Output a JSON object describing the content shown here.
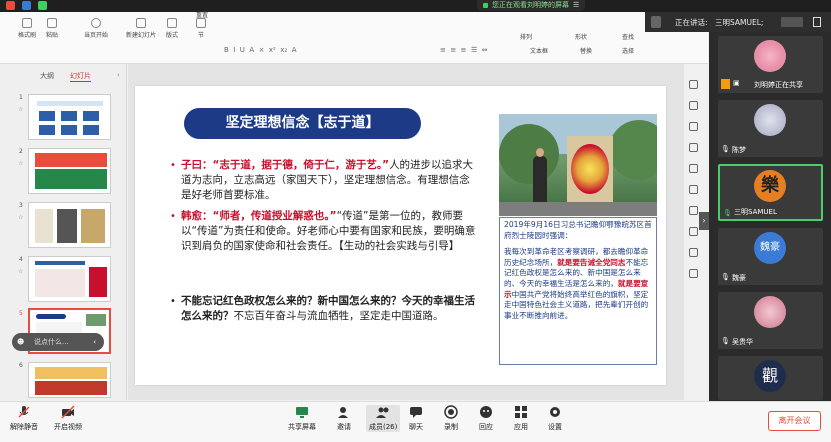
{
  "notice": {
    "text": "您正在观看刘明婷的屏幕"
  },
  "speaking": {
    "label": "正在讲话:",
    "name": "三明SAMUEL;"
  },
  "toolbar": {
    "buttons": [
      "格式刷",
      "粘贴",
      "当页开始",
      "新建幻灯片",
      "版式",
      "节",
      "重置",
      "文本框",
      "形状",
      "排列",
      "查找",
      "选择",
      "替换"
    ]
  },
  "thumbpanel": {
    "tab_outline": "大纲",
    "tab_slides": "幻灯片",
    "numbers": [
      "1",
      "2",
      "3",
      "4",
      "5",
      "6"
    ]
  },
  "slide": {
    "title": "坚定理想信念【志于道】",
    "p1_quote": "子曰：“志于道，据于德，倚于仁，游于艺。”",
    "p1_rest": "人的进步以追求大道为志向，立志高远（家国天下），坚定理想信念。有理想信念是好老师首要标准。",
    "p2_quote": "韩愈：“师者，传道授业解惑也。”",
    "p2_rest": "“传道”是第一位的，教师要以“传道”为责任和使命。好老师心中要有国家和民族，要明确意识到肩负的国家使命和社会责任。【生动的社会实践与引导】",
    "p3_bold": "不能忘记红色政权怎么来的？新中国怎么来的？今天的幸福生活怎么来的？",
    "p3_rest": "不忘百年奋斗与流血牺牲，坚定走中国道路。",
    "caption_head": "2019年9月16日习总书记瞻仰鄂豫皖苏区首府烈士陵园时强调：",
    "caption_a": "我每次到革命老区考察调研，都去瞻仰革命历史纪念场所，",
    "caption_b": "就是要告诫全党同志",
    "caption_c": "不能忘记红色政权是怎么来的、新中国是怎么来的、今天的幸福生活是怎么来的，",
    "caption_d": "就是要宣示",
    "caption_e": "中国共产党将始终高举红色的旗帜，坚定走中国特色社会主义道路，把先辈们开创的事业不断推向前进。"
  },
  "participants": [
    {
      "name": "刘明婷正在共享"
    },
    {
      "name": "陈梦"
    },
    {
      "name": "三明SAMUEL"
    },
    {
      "name": "魏豪"
    },
    {
      "name": "吴贵华"
    },
    {
      "name": ""
    }
  ],
  "avatar_chars": {
    "samuel": "樂",
    "weihao": "魏豪",
    "last": "觀"
  },
  "chat_popup": "说点什么...",
  "bottom": {
    "mute": "解除静音",
    "video": "开启视频",
    "share": "共享屏幕",
    "invite": "邀请",
    "members": "成员(26)",
    "chat": "聊天",
    "record": "录制",
    "reply": "回应",
    "apps": "应用",
    "settings": "设置",
    "leave": "离开会议"
  },
  "colors": {
    "accent_red": "#c8102e",
    "title_blue": "#1d3a86",
    "speaking_green": "#45d06a",
    "leave_red": "#e74c3c"
  }
}
